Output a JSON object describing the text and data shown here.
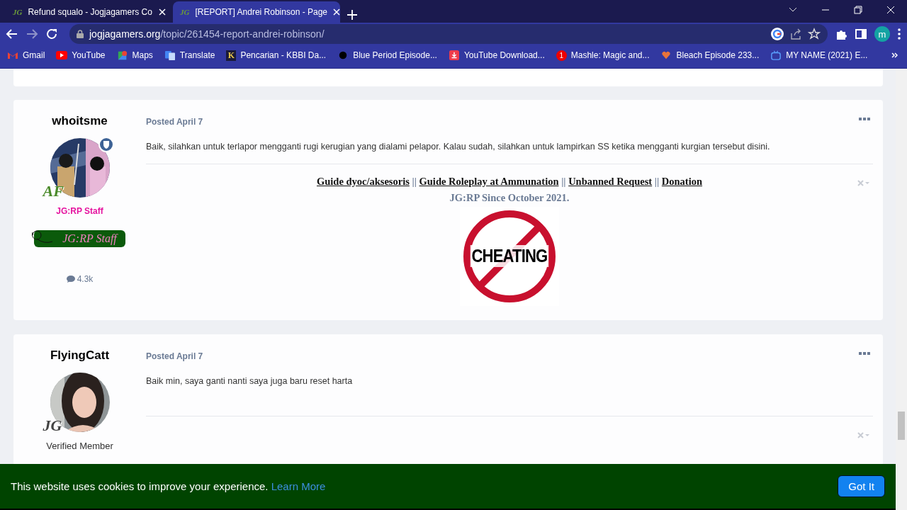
{
  "browser": {
    "tabs": [
      {
        "favicon": "JG",
        "title": "Refund squalo - Jogjagamers Co",
        "selected": false
      },
      {
        "favicon": "JG",
        "title": "[REPORT] Andrei Robinson - Page",
        "selected": true
      }
    ],
    "url_host": "jogjagamers.org",
    "url_path": "/topic/261454-report-andrei-robinson/",
    "profile_initial": "m",
    "bookmarks": [
      {
        "kind": "gmail",
        "label": "Gmail"
      },
      {
        "kind": "youtube",
        "label": "YouTube"
      },
      {
        "kind": "maps",
        "label": "Maps"
      },
      {
        "kind": "translate",
        "label": "Translate"
      },
      {
        "kind": "letter",
        "icon_text": "K",
        "label": "Pencarian - KBBI Da..."
      },
      {
        "kind": "blob",
        "label": "Blue Period Episode..."
      },
      {
        "kind": "download",
        "label": "YouTube Download..."
      },
      {
        "kind": "count",
        "icon_text": "1",
        "label": "Mashle: Magic and..."
      },
      {
        "kind": "heart",
        "label": "Bleach Episode 233..."
      },
      {
        "kind": "tv",
        "label": "MY NAME (2021) E..."
      }
    ]
  },
  "posts": [
    {
      "author": "whoitsme",
      "rank_badge": "AF",
      "kind": "staff",
      "moderator": true,
      "group": "JG:RP Staff",
      "staff_banner": "JG:RP Staff",
      "reputation": "4.3k",
      "date": "Posted April 7",
      "body": "Baik, silahkan untuk terlapor mengganti rugi kerugian yang dialami pelapor. Kalau sudah, silahkan untuk lampirkan SS ketika mengganti kurgian tersebut disini.",
      "signature": {
        "links": [
          "Guide dyoc/aksesoris",
          "Guide Roleplay at Ammunation",
          "Unbanned Request",
          "Donation"
        ],
        "separator": "||",
        "line": "JG:RP Since October 2021.",
        "image_text": "CHEATING"
      }
    },
    {
      "author": "FlyingCatt",
      "rank_badge": "JG",
      "kind": "member",
      "moderator": false,
      "group": "Verified Member",
      "date": "Posted April 7",
      "body": "Baik min, saya ganti nanti saya juga baru reset harta"
    }
  ],
  "cookie_bar": {
    "message": "This website uses cookies to improve your experience.",
    "link": "Learn More",
    "button": "Got It"
  }
}
